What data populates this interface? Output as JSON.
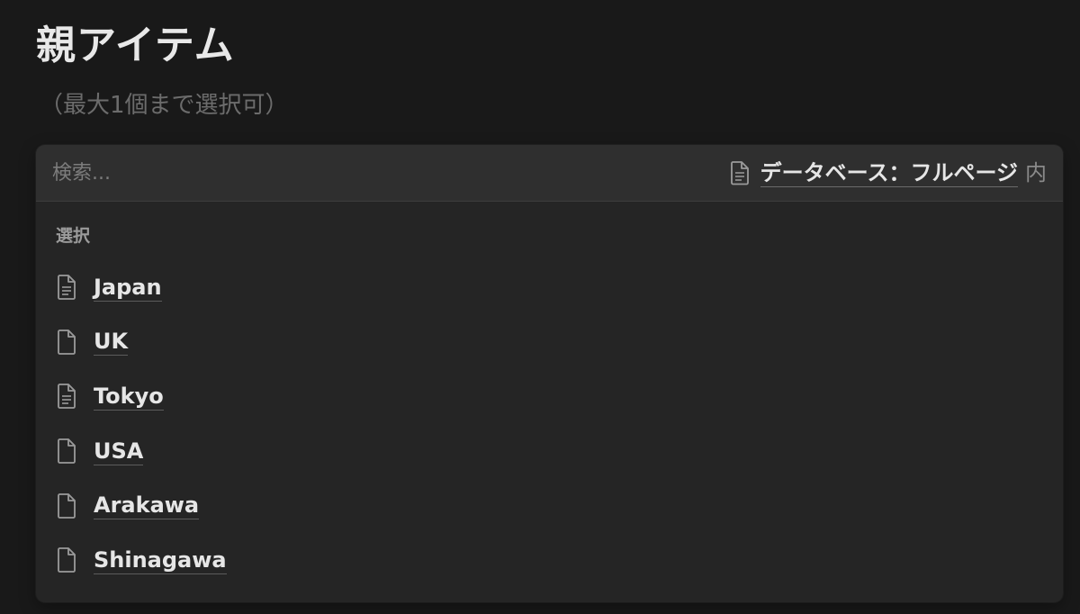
{
  "header": {
    "title": "親アイテム",
    "subtitle": "（最大1個まで選択可）"
  },
  "search": {
    "placeholder": "検索...",
    "scope_source": "データベース：フルページ",
    "scope_suffix": "内",
    "scope_icon": "document-icon"
  },
  "section": {
    "label": "選択"
  },
  "items": [
    {
      "label": "Japan",
      "icon": "document-text-icon"
    },
    {
      "label": "UK",
      "icon": "document-icon"
    },
    {
      "label": "Tokyo",
      "icon": "document-text-icon"
    },
    {
      "label": "USA",
      "icon": "document-icon"
    },
    {
      "label": "Arakawa",
      "icon": "document-icon"
    },
    {
      "label": "Shinagawa",
      "icon": "document-icon"
    }
  ],
  "colors": {
    "background": "#191919",
    "panel": "#252525",
    "search_bar": "#2f2f2f",
    "text_primary": "#e6e6e6",
    "text_muted": "#9b9b9b"
  }
}
